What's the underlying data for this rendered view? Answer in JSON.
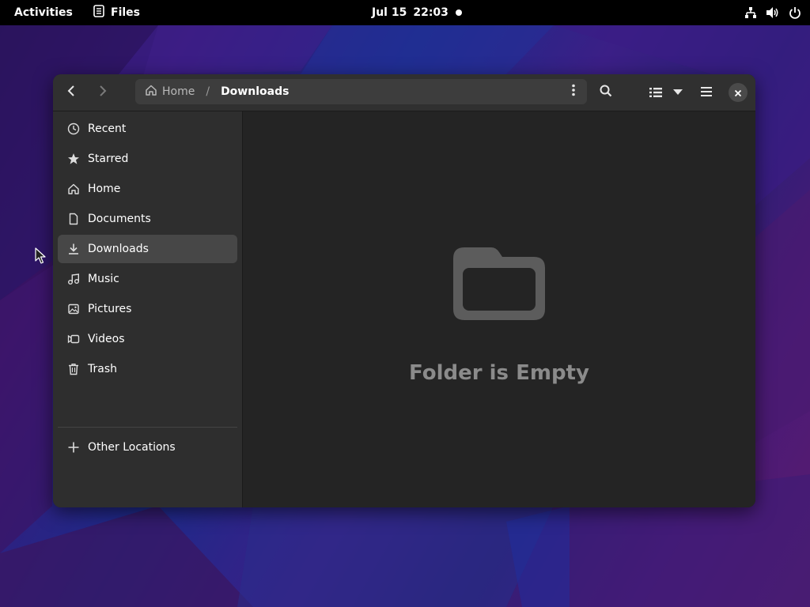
{
  "topbar": {
    "activities": "Activities",
    "app_name": "Files",
    "date": "Jul 15",
    "time": "22:03",
    "tray_icons": [
      "network-icon",
      "volume-icon",
      "power-icon"
    ]
  },
  "window": {
    "pathbar": {
      "home_label": "Home",
      "separator": "/",
      "current": "Downloads"
    },
    "sidebar": {
      "items": [
        {
          "label": "Recent",
          "icon": "clock-icon"
        },
        {
          "label": "Starred",
          "icon": "star-icon"
        },
        {
          "label": "Home",
          "icon": "home-icon"
        },
        {
          "label": "Documents",
          "icon": "document-icon"
        },
        {
          "label": "Downloads",
          "icon": "download-icon",
          "selected": true
        },
        {
          "label": "Music",
          "icon": "music-icon"
        },
        {
          "label": "Pictures",
          "icon": "picture-icon"
        },
        {
          "label": "Videos",
          "icon": "video-icon"
        },
        {
          "label": "Trash",
          "icon": "trash-icon"
        }
      ],
      "other_locations": "Other Locations"
    },
    "content": {
      "empty_message": "Folder is Empty"
    }
  },
  "colors": {
    "window_bg": "#242424",
    "sidebar_bg": "#2e2e2e",
    "headerbar_bg": "#303030",
    "selected_bg": "#474747",
    "empty_text": "#8b8b8b"
  }
}
